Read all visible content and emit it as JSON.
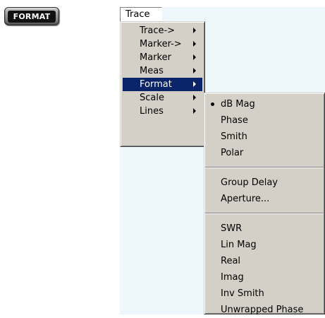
{
  "hardkey": {
    "label": "FORMAT"
  },
  "menubar": {
    "trace_label": "Trace"
  },
  "trace_menu": {
    "items": [
      {
        "label": "Trace->"
      },
      {
        "label": "Marker->"
      },
      {
        "label": "Marker"
      },
      {
        "label": "Meas"
      },
      {
        "label": "Format"
      },
      {
        "label": "Scale"
      },
      {
        "label": "Lines"
      }
    ],
    "selected": "Format"
  },
  "format_menu": {
    "group1": [
      "dB Mag",
      "Phase",
      "Smith",
      "Polar"
    ],
    "group2": [
      "Group Delay",
      "Aperture..."
    ],
    "group3": [
      "SWR",
      "Lin Mag",
      "Real",
      "Imag",
      "Inv Smith",
      "Unwrapped Phase"
    ],
    "checked": "dB Mag"
  },
  "colors": {
    "menu_bg": "#d4d0c8",
    "highlight": "#0a246a",
    "app_bg": "#eef7fb"
  }
}
